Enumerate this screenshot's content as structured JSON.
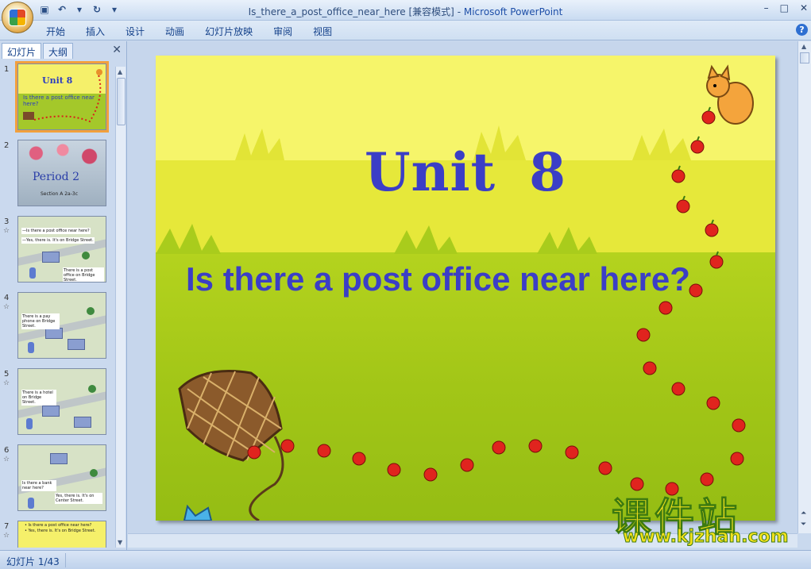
{
  "window": {
    "title": "Is_there_a_post_office_near_here [兼容模式]",
    "separator": "-",
    "app_name": "Microsoft PowerPoint",
    "minimize": "–",
    "restore": "□",
    "close": "✕"
  },
  "ribbon": {
    "tabs": [
      "开始",
      "插入",
      "设计",
      "动画",
      "幻灯片放映",
      "审阅",
      "视图"
    ],
    "help": "?"
  },
  "left_pane": {
    "tabs": [
      "幻灯片",
      "大纲"
    ],
    "close": "✕",
    "slides": [
      {
        "num": "1",
        "title": "Unit 8",
        "subtitle": "Is there a post office near here?"
      },
      {
        "num": "2",
        "title": "Period 2",
        "subtitle": "Section A 2a-3c"
      },
      {
        "num": "3",
        "star": "☆",
        "labels": [
          "—Is there a post office near here?",
          "—Yes, there is. It's on Bridge Street.",
          "There is a post office on Bridge Street."
        ]
      },
      {
        "num": "4",
        "star": "☆",
        "labels": [
          "There is a pay phone on Bridge Street."
        ]
      },
      {
        "num": "5",
        "star": "☆",
        "labels": [
          "There is a hotel on Bridge Street."
        ]
      },
      {
        "num": "6",
        "star": "☆",
        "labels": [
          "Is there a bank near here?",
          "Yes, there is. It's on Center Street."
        ]
      },
      {
        "num": "7",
        "star": "☆",
        "labels": [
          "• Is there a post office near here?",
          "• Yes, there is. It's on Bridge Street."
        ]
      }
    ]
  },
  "slide": {
    "title": "Unit  8",
    "subtitle": "Is there a post office near here?"
  },
  "status": {
    "slide_indicator": "幻灯片 1/43"
  },
  "watermark": {
    "cn": "课件站",
    "url": "www.kjzhan.com"
  },
  "colors": {
    "slide_text": "#3b3ec6",
    "slide_top": "#f6f56a",
    "grass": "#a2c617",
    "apple": "#e0241e"
  }
}
